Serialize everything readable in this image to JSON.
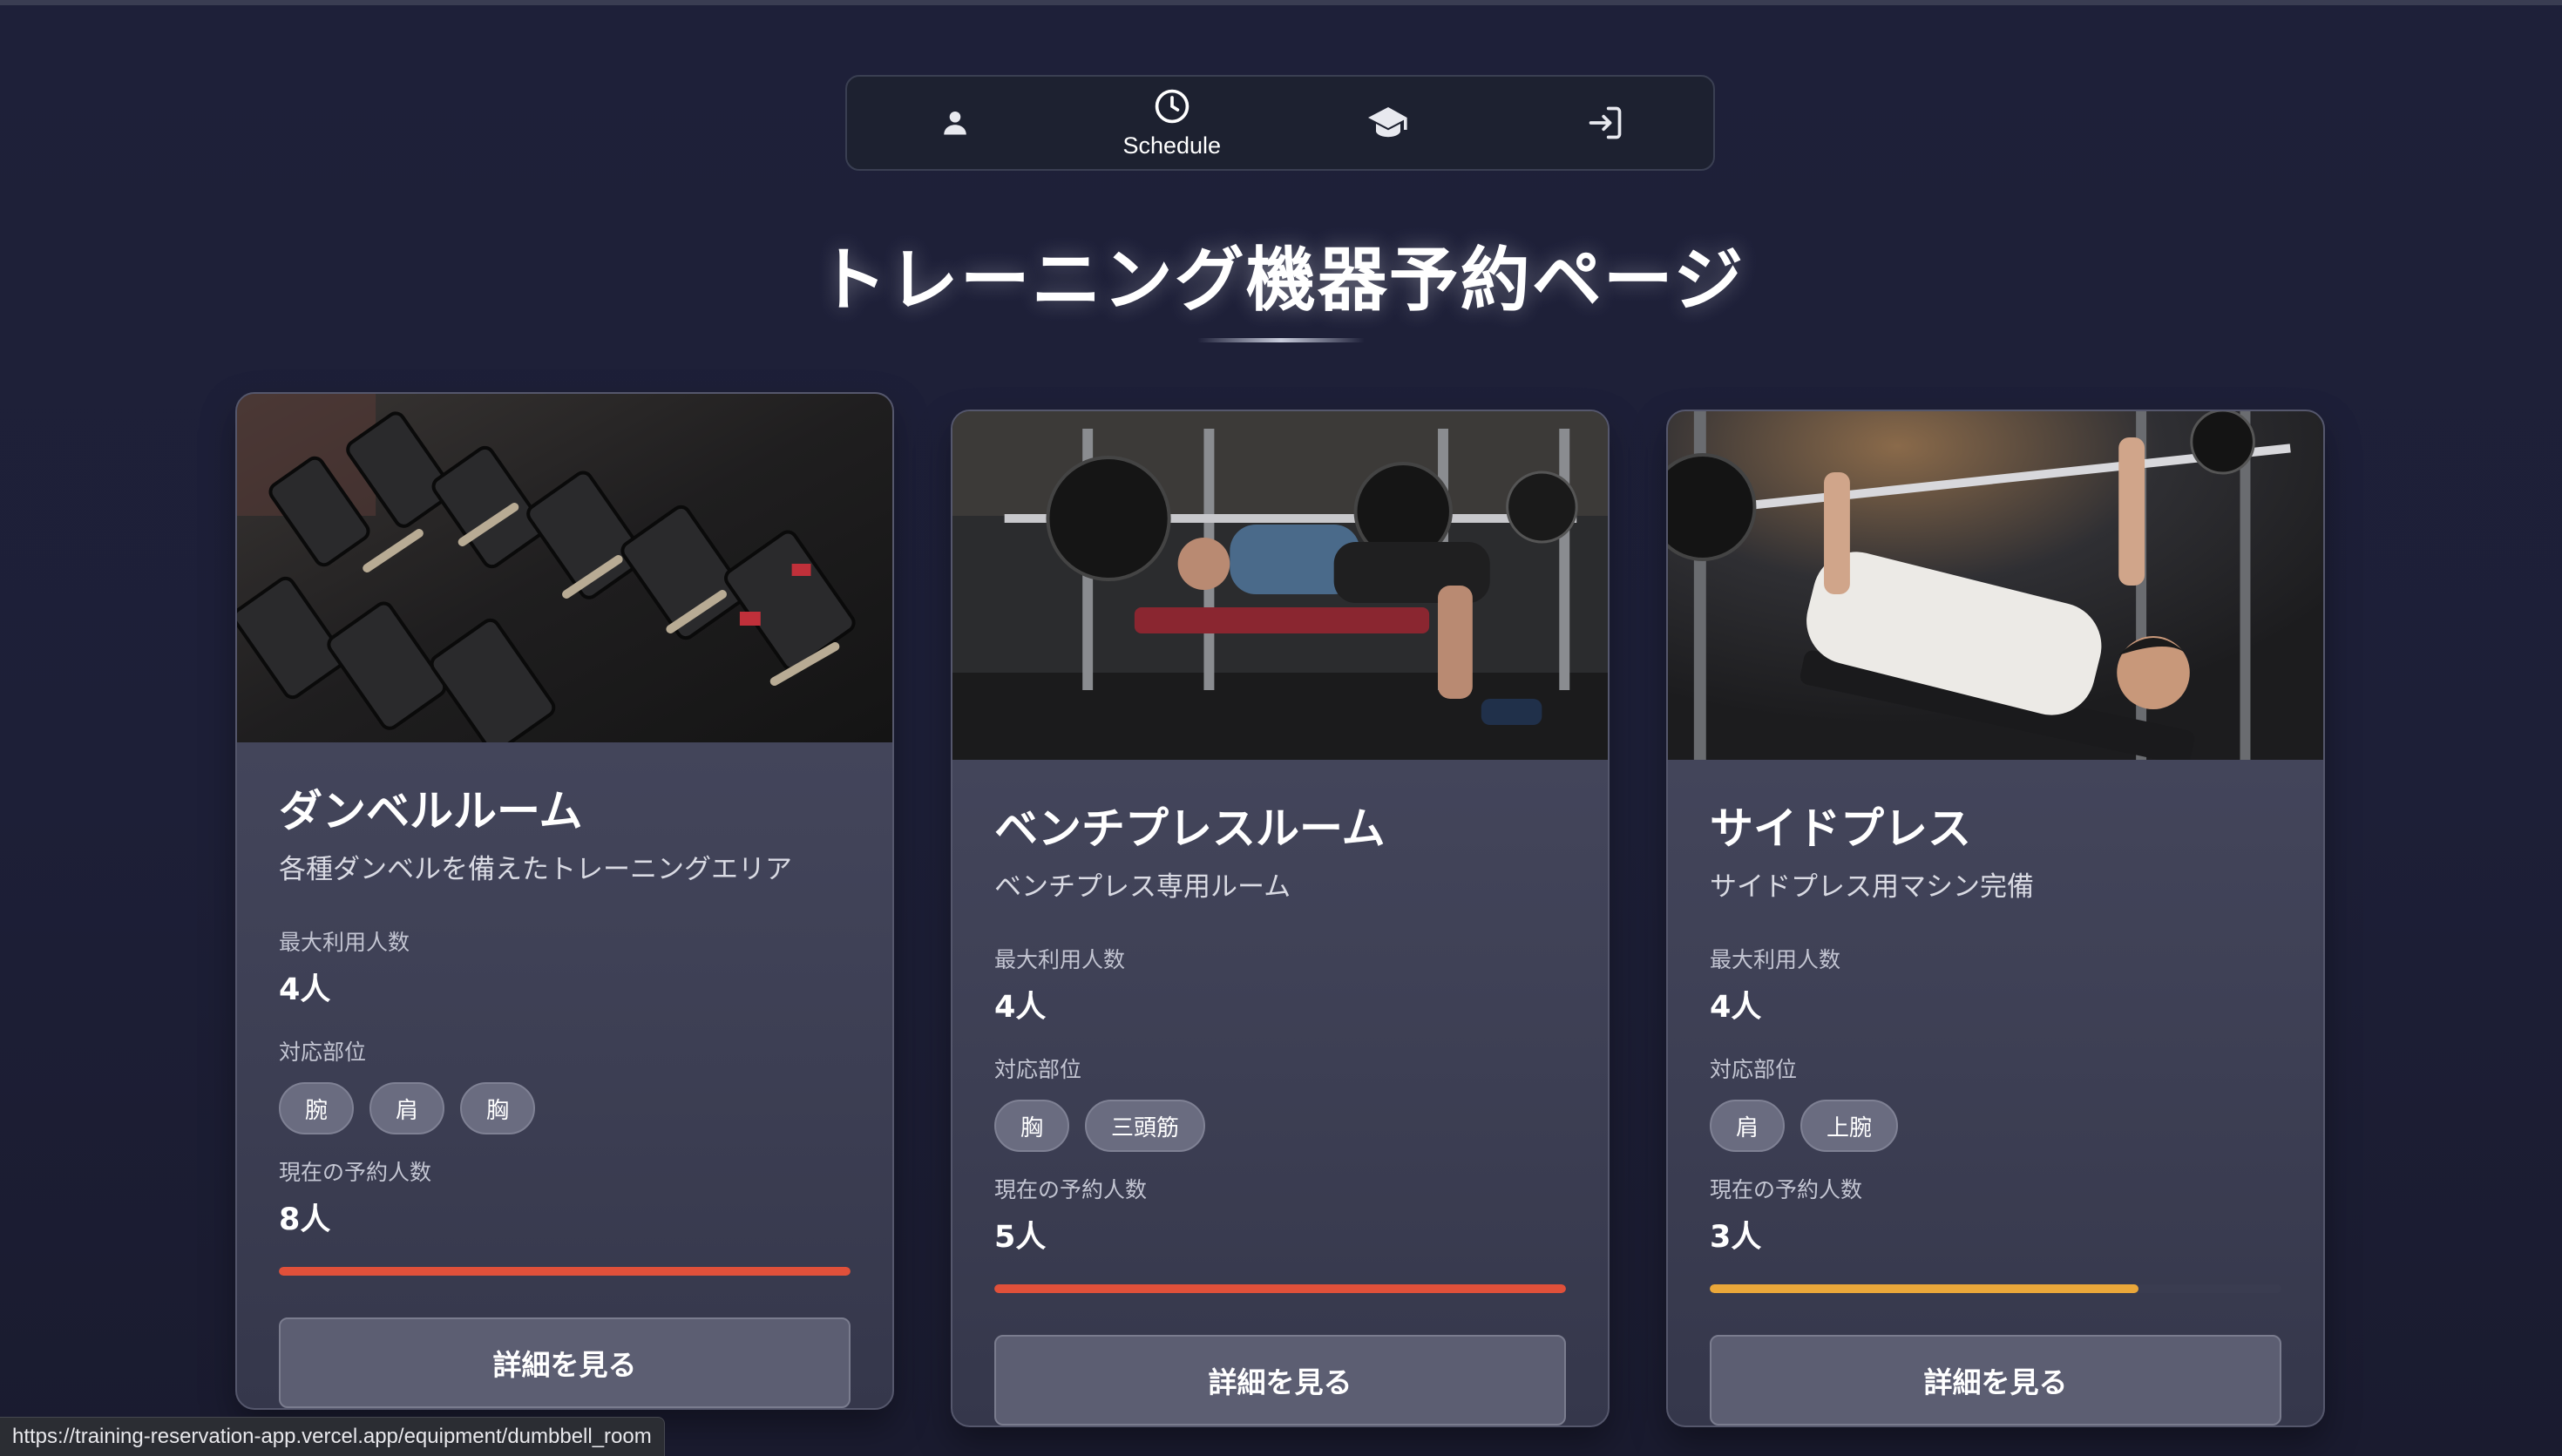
{
  "nav": {
    "items": [
      {
        "icon": "user-icon",
        "label": ""
      },
      {
        "icon": "clock-icon",
        "label": "Schedule"
      },
      {
        "icon": "graduation-cap-icon",
        "label": ""
      },
      {
        "icon": "login-icon",
        "label": ""
      }
    ]
  },
  "page": {
    "title": "トレーニング機器予約ページ"
  },
  "labels": {
    "max_users": "最大利用人数",
    "body_parts": "対応部位",
    "current_reservations": "現在の予約人数",
    "detail_button": "詳細を見る"
  },
  "cards": [
    {
      "title": "ダンベルルーム",
      "description": "各種ダンベルを備えたトレーニングエリア",
      "max_users": "4人",
      "tags": [
        "腕",
        "肩",
        "胸"
      ],
      "reservations": "8人",
      "progress": 1.0,
      "progress_color": "#e0503a",
      "image": "dumbbell-rack-photo"
    },
    {
      "title": "ベンチプレスルーム",
      "description": "ベンチプレス専用ルーム",
      "max_users": "4人",
      "tags": [
        "胸",
        "三頭筋"
      ],
      "reservations": "5人",
      "progress": 1.0,
      "progress_color": "#e0503a",
      "image": "bench-press-photo"
    },
    {
      "title": "サイドプレス",
      "description": "サイドプレス用マシン完備",
      "max_users": "4人",
      "tags": [
        "肩",
        "上腕"
      ],
      "reservations": "3人",
      "progress": 0.75,
      "progress_color": "#eaa73a",
      "image": "side-press-photo"
    }
  ],
  "status_bar": {
    "url": "https://training-reservation-app.vercel.app/equipment/dumbbell_room"
  }
}
